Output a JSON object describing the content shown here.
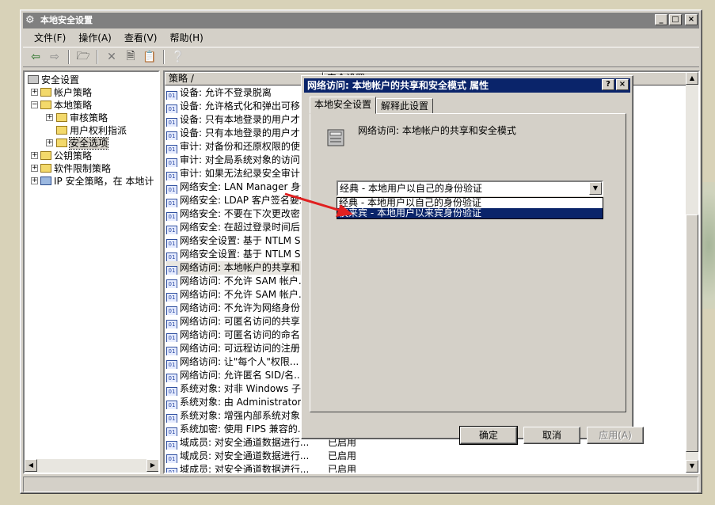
{
  "window": {
    "title": "本地安全设置",
    "min": "_",
    "max": "□",
    "close": "×"
  },
  "menu": [
    "文件(F)",
    "操作(A)",
    "查看(V)",
    "帮助(H)"
  ],
  "tree": {
    "root": "安全设置",
    "items": [
      "帐户策略",
      "本地策略",
      "审核策略",
      "用户权利指派",
      "安全选项",
      "公钥策略",
      "软件限制策略",
      "IP 安全策略，在 本地计"
    ]
  },
  "list": {
    "col_policy": "策略 /",
    "col_setting": "安全设置",
    "rows": [
      "设备: 允许不登录脱离",
      "设备: 允许格式化和弹出可移...",
      "设备: 只有本地登录的用户才...",
      "设备: 只有本地登录的用户才...",
      "审计: 对备份和还原权限的使...",
      "审计: 对全局系统对象的访问...",
      "审计: 如果无法纪录安全审计...",
      "网络安全: LAN Manager 身份...",
      "网络安全: LDAP 客户签名要求",
      "网络安全: 不要在下次更改密...",
      "网络安全: 在超过登录时间后...",
      "网络安全设置: 基于 NTLM SS...",
      "网络安全设置: 基于 NTLM SS...",
      "网络访问: 本地帐户的共享和...",
      "网络访问: 不允许 SAM 帐户...",
      "网络访问: 不允许 SAM 帐户...",
      "网络访问: 不允许为网络身份...",
      "网络访问: 可匿名访问的共享",
      "网络访问: 可匿名访问的命名...",
      "网络访问: 可远程访问的注册...",
      "网络访问: 让\"每个人\"权限...",
      "网络访问: 允许匿名 SID/名...",
      "系统对象: 对非 Windows 子...",
      "系统对象: 由 Administrator...",
      "系统对象: 增强内部系统对象...",
      "系统加密: 使用 FIPS 兼容的...",
      "域成员: 对安全通道数据进行...",
      "域成员: 对安全通道数据进行...",
      "域成员: 对安全通道数据进行..."
    ],
    "values": {
      "26": "已启用",
      "27": "已启用",
      "28": "已启用"
    }
  },
  "dialog": {
    "title": "网络访问: 本地帐户的共享和安全模式 属性",
    "help": "?",
    "close": "×",
    "tabs": [
      "本地安全设置",
      "解释此设置"
    ],
    "policy_name": "网络访问: 本地帐户的共享和安全模式",
    "combo_value": "经典 - 本地用户以自己的身份验证",
    "options": [
      "经典 - 本地用户以自己的身份验证",
      "仅来宾 - 本地用户以来宾身份验证"
    ],
    "ok": "确定",
    "cancel": "取消",
    "apply": "应用(A)"
  },
  "colors": {
    "title_inactive": "#808080",
    "title_active": "#0a246a",
    "arrow": "#e02020"
  }
}
